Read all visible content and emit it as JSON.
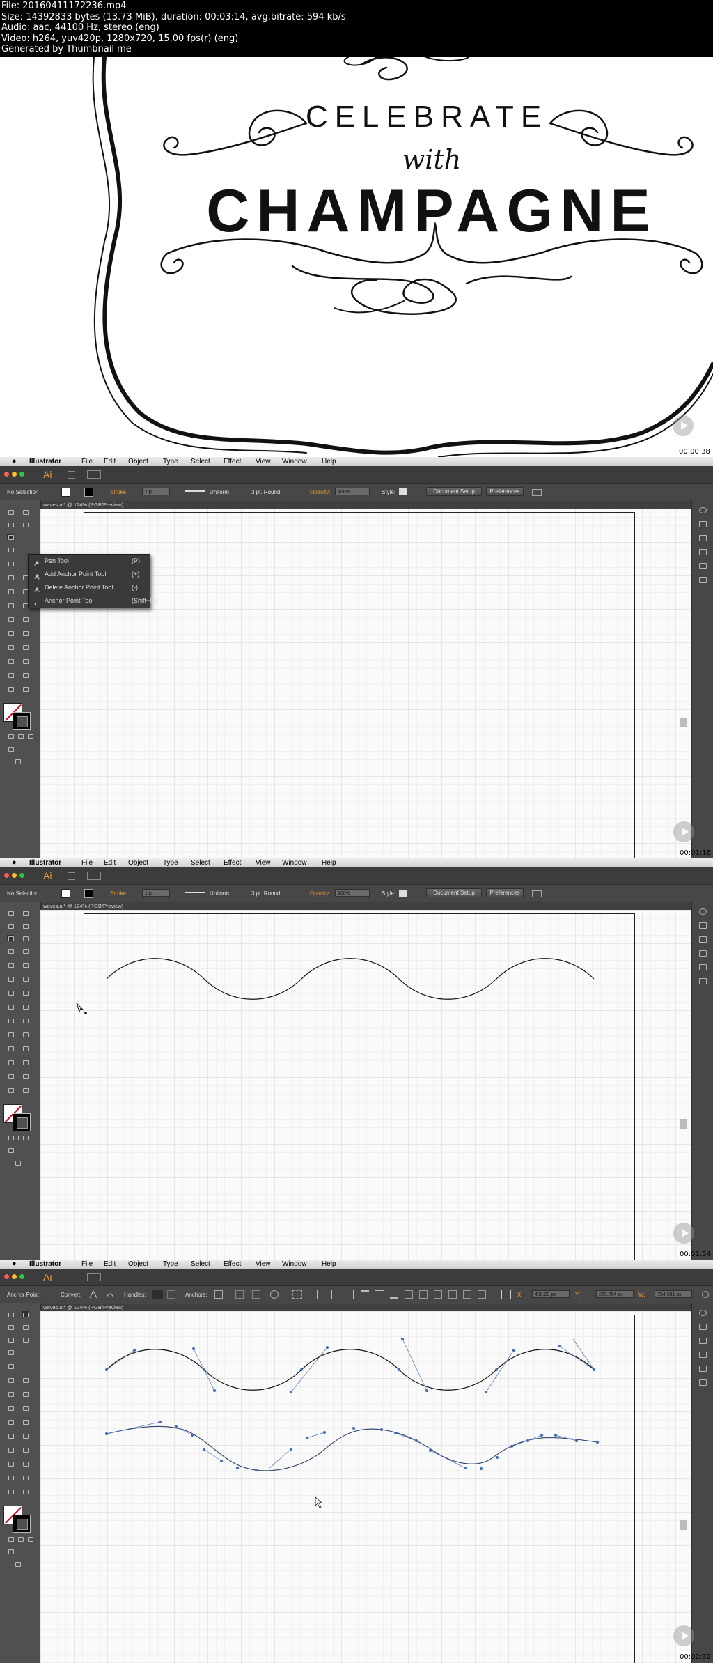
{
  "meta_header": {
    "file": "File: 20160411172236.mp4",
    "size": "Size: 14392833 bytes (13.73 MiB), duration: 00:03:14, avg.bitrate: 594 kb/s",
    "audio": "Audio: aac, 44100 Hz, stereo (eng)",
    "video": "Video: h264, yuv420p, 1280x720, 15.00 fps(r) (eng)",
    "generated": "Generated by Thumbnail me"
  },
  "title_card": {
    "line1": "CELEBRATE",
    "line2": "with",
    "line3": "CHAMPAGNE",
    "timestamp": "00:00:38"
  },
  "menu": {
    "apple": "",
    "app": "Illustrator",
    "items": [
      "File",
      "Edit",
      "Object",
      "Type",
      "Select",
      "Effect",
      "View",
      "Window",
      "Help"
    ]
  },
  "appbar": {
    "logo": "Ai"
  },
  "control_bar": {
    "no_selection": "No Selection",
    "stroke_label": "Stroke",
    "stroke_weight": "1 pt",
    "profile": "Uniform",
    "brush": "3 pt. Round",
    "opacity_label": "Opacity:",
    "opacity_value": "100%",
    "style_label": "Style:",
    "doc_setup": "Document Setup",
    "preferences": "Preferences"
  },
  "anchor_bar": {
    "title": "Anchor Point",
    "convert": "Convert:",
    "handles": "Handles:",
    "anchors": "Anchors:",
    "x_label": "X:",
    "x_value": "408.29 px",
    "y_label": "Y:",
    "y_value": "229.764 px",
    "w_label": "W:",
    "w_value": "754.581 px"
  },
  "document": {
    "tab": "waves.ai* @ 124% (RGB/Preview)"
  },
  "pen_flyout": [
    {
      "label": "Pen Tool",
      "shortcut": "(P)",
      "icon": "pen-icon"
    },
    {
      "label": "Add Anchor Point Tool",
      "shortcut": "(+)",
      "icon": "add-anchor-icon"
    },
    {
      "label": "Delete Anchor Point Tool",
      "shortcut": "(-)",
      "icon": "delete-anchor-icon"
    },
    {
      "label": "Anchor Point Tool",
      "shortcut": "(Shift+C)",
      "icon": "anchor-point-icon"
    }
  ],
  "frames": [
    {
      "timestamp": "00:01:16"
    },
    {
      "timestamp": "00:01:54"
    },
    {
      "timestamp": "00:02:32"
    }
  ],
  "colors": {
    "stroke_orange": "#e79a3c",
    "path_blue": "#4a6fb5",
    "ui_dark": "#535353"
  }
}
